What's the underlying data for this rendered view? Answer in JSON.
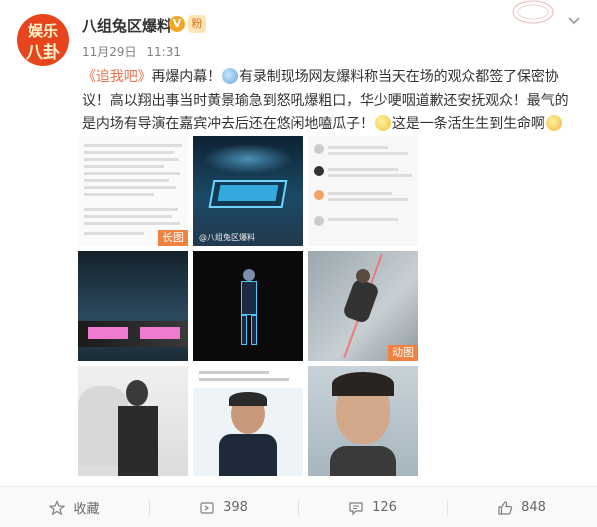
{
  "post": {
    "author": "八组兔区爆料",
    "verified_mark": "V",
    "fan_mark": "粉",
    "date": "11月29日",
    "time": "11:31",
    "avatar_line1": "娱乐",
    "avatar_line2": "八卦",
    "hashtag": "《追我吧》",
    "text_a": "再爆内幕！",
    "text_b": "有录制现场网友爆料称当天在场的观众都签了保密协议！高以翔出事当时黄景瑜急到怒吼爆粗口，华少哽咽道歉还安抚观众！最气的是内场有导演在嘉宾冲去后还在悠闲地嗑瓜子！",
    "text_c": "这是一条活生生到生命啊",
    "emoji_1": "thinking-emoji",
    "emoji_2": "drooling-emoji",
    "emoji_3": "crying-emoji"
  },
  "images": [
    {
      "name": "long-screenshot",
      "label": "长图",
      "watermark": ""
    },
    {
      "name": "stage-logo",
      "label": "",
      "watermark": "@八组兔区爆料"
    },
    {
      "name": "stage-show",
      "label": "",
      "watermark": ""
    },
    {
      "name": "performer-stage",
      "label": "",
      "watermark": ""
    },
    {
      "name": "rope-climb",
      "label": "动图",
      "watermark": ""
    },
    {
      "name": "portrait-horse",
      "label": "",
      "watermark": ""
    },
    {
      "name": "screenshot-smile",
      "label": "",
      "watermark": ""
    },
    {
      "name": "portrait-face",
      "label": "",
      "watermark": ""
    },
    {
      "name": "extra",
      "label": "",
      "watermark": ""
    }
  ],
  "footer": {
    "favorite": "收藏",
    "repost": "398",
    "comment": "126",
    "like": "848"
  },
  "colors": {
    "accent": "#eb7350",
    "label_bg": "#f08140",
    "text": "#333333",
    "meta": "#808080"
  }
}
